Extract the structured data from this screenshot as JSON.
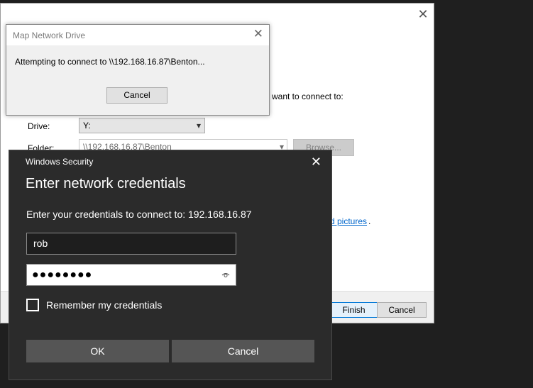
{
  "wizard": {
    "close_glyph": "✕",
    "instruction_tail": "want to connect to:",
    "drive_label": "Drive:",
    "drive_value": "Y:",
    "folder_label": "Folder:",
    "folder_value": "\\\\192.168.16.87\\Benton",
    "browse_label": "Browse...",
    "link_text": "d pictures",
    "link_suffix": ".",
    "finish_label": "Finish",
    "cancel_label": "Cancel"
  },
  "connect_dialog": {
    "title": "Map Network Drive",
    "close_glyph": "✕",
    "message": "Attempting to connect to \\\\192.168.16.87\\Benton...",
    "cancel_label": "Cancel"
  },
  "security_dialog": {
    "title": "Windows Security",
    "close_glyph": "✕",
    "heading": "Enter network credentials",
    "subtext": "Enter your credentials to connect to: 192.168.16.87",
    "username_value": "rob",
    "password_masked": "●●●●●●●●",
    "remember_label": "Remember my credentials",
    "remember_checked": false,
    "ok_label": "OK",
    "cancel_label": "Cancel"
  },
  "icons": {
    "chevron": "⌄",
    "eye": "👁"
  }
}
